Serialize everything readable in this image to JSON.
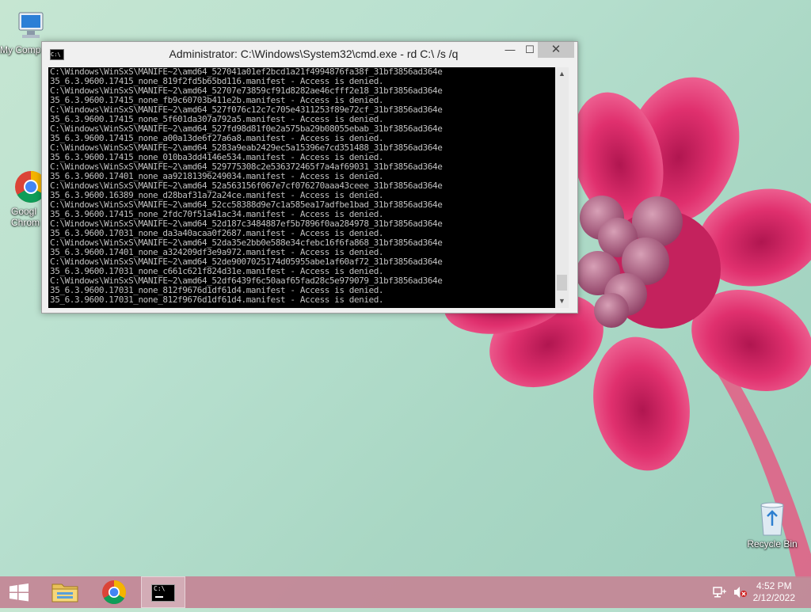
{
  "desktop": {
    "icons": [
      {
        "label": "My Comp",
        "icon": "computer-icon"
      },
      {
        "label": "Googl Chrom",
        "label_line1": "Googl",
        "label_line2": "Chrom",
        "icon": "chrome-icon"
      },
      {
        "label": "Recycle Bin",
        "icon": "recycle-bin-icon"
      }
    ]
  },
  "cmd_window": {
    "title": "Administrator: C:\\Windows\\System32\\cmd.exe - rd  C:\\ /s /q",
    "icon": "cmd-icon",
    "icon_text": "C:\\",
    "buttons": {
      "minimize": "—",
      "maximize": "☐",
      "close": "✕"
    },
    "console_lines": [
      "C:\\Windows\\WinSxS\\MANIFE~2\\amd64_527041a01ef2bcd1a21f4994876fa38f_31bf3856ad364e",
      "35_6.3.9600.17415_none_819f2fd5b65bd116.manifest - Access is denied.",
      "C:\\Windows\\WinSxS\\MANIFE~2\\amd64_52707e73859cf91d8282ae46cfff2e18_31bf3856ad364e",
      "35_6.3.9600.17415_none_fb9c60703b411e2b.manifest - Access is denied.",
      "C:\\Windows\\WinSxS\\MANIFE~2\\amd64_527f076c12c7c705e4311253f89e72cf_31bf3856ad364e",
      "35_6.3.9600.17415_none_5f601da307a792a5.manifest - Access is denied.",
      "C:\\Windows\\WinSxS\\MANIFE~2\\amd64_527fd98d81f0e2a575ba29b08055ebab_31bf3856ad364e",
      "35_6.3.9600.17415_none_a00a13de6f27a6a8.manifest - Access is denied.",
      "C:\\Windows\\WinSxS\\MANIFE~2\\amd64_5283a9eab2429ec5a15396e7cd351488_31bf3856ad364e",
      "35_6.3.9600.17415_none_010ba3dd4146e534.manifest - Access is denied.",
      "C:\\Windows\\WinSxS\\MANIFE~2\\amd64_529775308c2e536372465f7a4af69031_31bf3856ad364e",
      "35_6.3.9600.17401_none_aa92181396249034.manifest - Access is denied.",
      "C:\\Windows\\WinSxS\\MANIFE~2\\amd64_52a563156f067e7cf076270aaa43ceee_31bf3856ad364e",
      "35_6.3.9600.16389_none_d28baf31a72a24ce.manifest - Access is denied.",
      "C:\\Windows\\WinSxS\\MANIFE~2\\amd64_52cc58388d9e7c1a585ea17adfbe1bad_31bf3856ad364e",
      "35_6.3.9600.17415_none_2fdc70f51a41ac34.manifest - Access is denied.",
      "C:\\Windows\\WinSxS\\MANIFE~2\\amd64_52d187c3484887ef5b7896f0aa284978_31bf3856ad364e",
      "35_6.3.9600.17031_none_da3a40acaa0f2687.manifest - Access is denied.",
      "C:\\Windows\\WinSxS\\MANIFE~2\\amd64_52da35e2bb0e588e34cfebc16f6fa868_31bf3856ad364e",
      "35_6.3.9600.17401_none_a324209df3e9a972.manifest - Access is denied.",
      "C:\\Windows\\WinSxS\\MANIFE~2\\amd64_52de9007025174d05955abe1af60af72_31bf3856ad364e",
      "35_6.3.9600.17031_none_c661c621f824d31e.manifest - Access is denied.",
      "C:\\Windows\\WinSxS\\MANIFE~2\\amd64_52df6439f6c50aaf65fad28c5e979079_31bf3856ad364e",
      "35_6.3.9600.17031_none_812f9676d1df61d4.manifest - Access is denied.",
      "35_6.3.9600.17031_none_812f9676d1df61d4.manifest - Access is denied."
    ],
    "scrollbar": {
      "up": "▲",
      "down": "▼"
    }
  },
  "taskbar": {
    "start_icon": "windows-logo-icon",
    "pinned": [
      {
        "name": "file-explorer",
        "icon": "folder-icon"
      },
      {
        "name": "google-chrome",
        "icon": "chrome-icon"
      },
      {
        "name": "command-prompt",
        "icon": "cmd-icon",
        "icon_text": "C:\\"
      }
    ],
    "tray": {
      "network_icon": "network-icon",
      "volume_icon": "volume-muted-icon",
      "time": "4:52 PM",
      "date": "2/12/2022"
    }
  },
  "colors": {
    "wallpaper": "#b8e0cf",
    "flower": "#e0306e",
    "taskbar": "#c48696",
    "console_bg": "#000000",
    "console_text": "#c0c0c0"
  }
}
